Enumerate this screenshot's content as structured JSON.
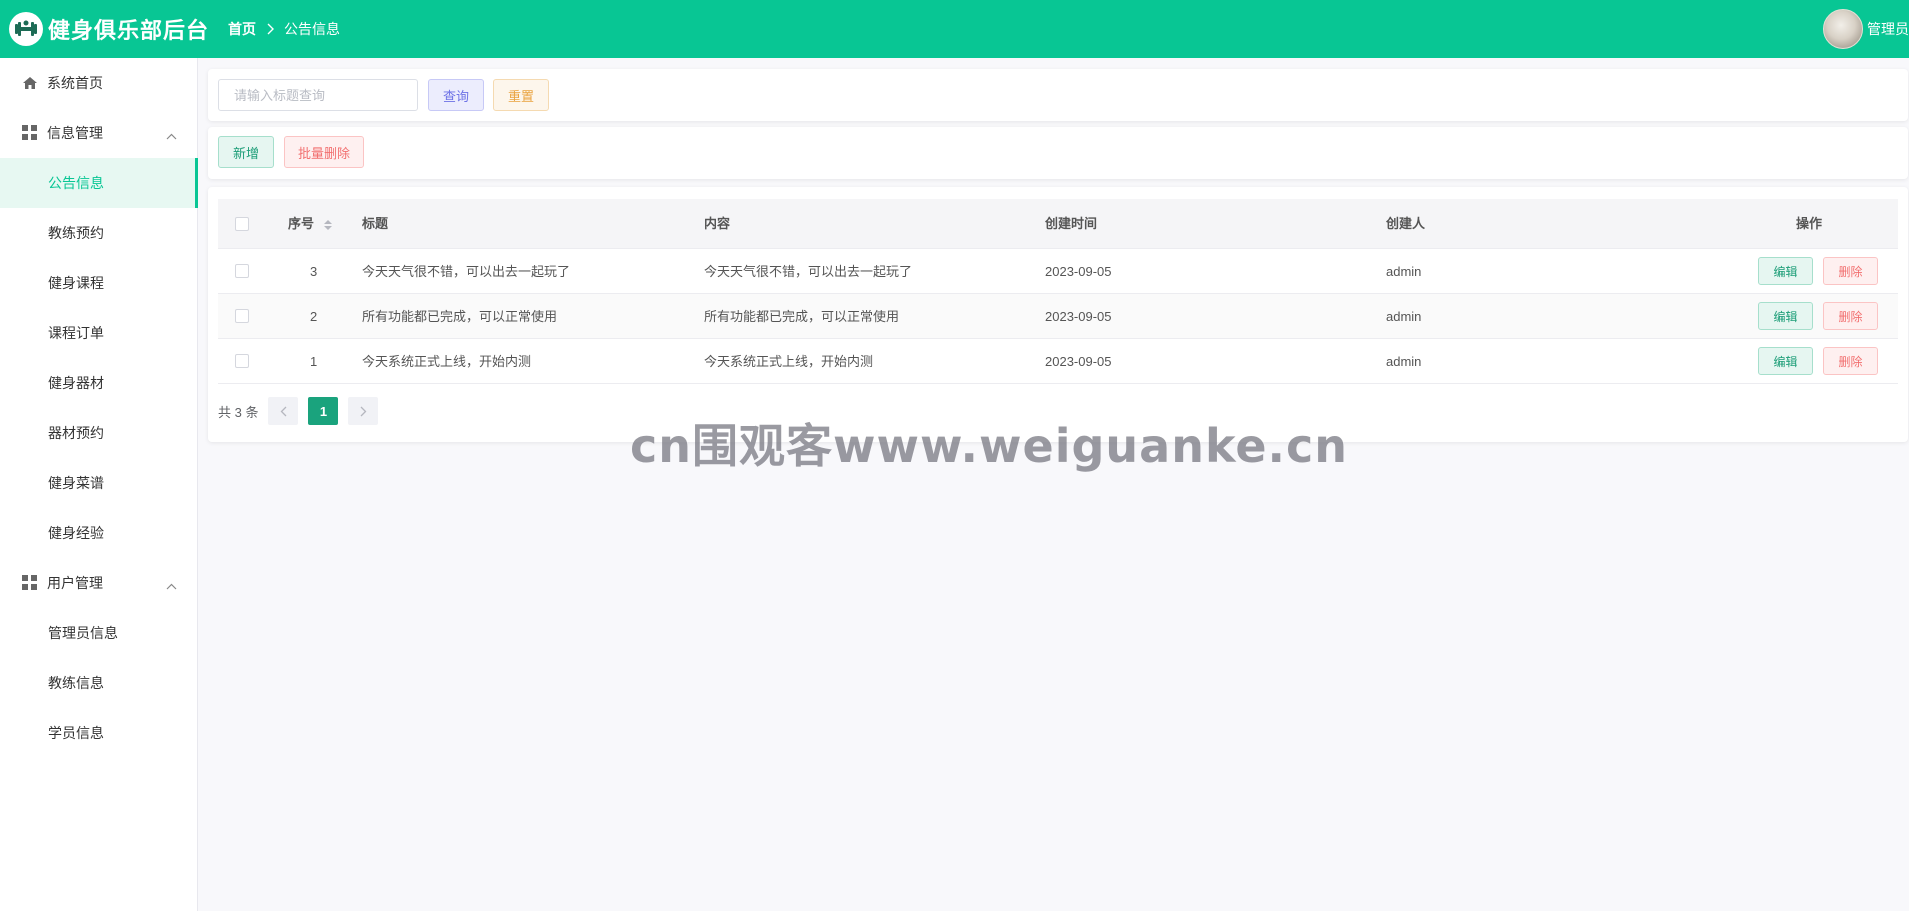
{
  "app": {
    "title": "健身俱乐部后台",
    "user_name": "管理员"
  },
  "breadcrumb": {
    "home": "首页",
    "current": "公告信息"
  },
  "sidebar": {
    "home": "系统首页",
    "group_info": "信息管理",
    "group_user": "用户管理",
    "info_items": [
      "公告信息",
      "教练预约",
      "健身课程",
      "课程订单",
      "健身器材",
      "器材预约",
      "健身菜谱",
      "健身经验"
    ],
    "user_items": [
      "管理员信息",
      "教练信息",
      "学员信息"
    ]
  },
  "search": {
    "placeholder": "请输入标题查询",
    "query_label": "查询",
    "reset_label": "重置"
  },
  "toolbar": {
    "add_label": "新增",
    "batch_delete_label": "批量删除"
  },
  "table": {
    "columns": {
      "index": "序号",
      "title": "标题",
      "content": "内容",
      "created_at": "创建时间",
      "creator": "创建人",
      "actions": "操作"
    },
    "rows": [
      {
        "index": "3",
        "title": "今天天气很不错，可以出去一起玩了",
        "content": "今天天气很不错，可以出去一起玩了",
        "created_at": "2023-09-05",
        "creator": "admin"
      },
      {
        "index": "2",
        "title": "所有功能都已完成，可以正常使用",
        "content": "所有功能都已完成，可以正常使用",
        "created_at": "2023-09-05",
        "creator": "admin"
      },
      {
        "index": "1",
        "title": "今天系统正式上线，开始内测",
        "content": "今天系统正式上线，开始内测",
        "created_at": "2023-09-05",
        "creator": "admin"
      }
    ],
    "edit_label": "编辑",
    "delete_label": "删除"
  },
  "pagination": {
    "total_label": "共 3 条",
    "current_page": "1"
  },
  "watermark": "cn围观客www.weiguanke.cn",
  "colors": {
    "brand": "#08c694",
    "active_bg": "#e7f8f2",
    "danger": "#f26f6f",
    "warning": "#eaa33f",
    "info": "#6d72e6"
  }
}
